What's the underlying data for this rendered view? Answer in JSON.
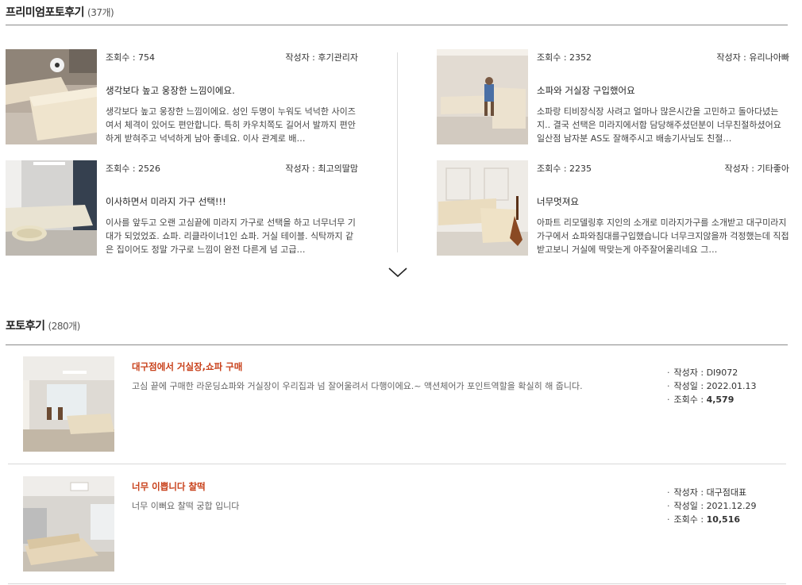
{
  "premium": {
    "title": "프리미엄포토후기",
    "count": "(37개)",
    "cards": [
      {
        "views": "조회수 : 754",
        "author": "작성자 : 후기관리자",
        "title": "생각보다 높고 웅장한 느낌이에요.",
        "desc": "생각보다 높고 웅장한 느낌이에요. 성인 두명이 누워도 넉넉한 사이즈여서 체격이 있어도 편안합니다. 특히 카우치쪽도 길어서 발까지 편안하게 받혀주고 넉넉하게 남아 좋네요. 이사 관계로 배…"
      },
      {
        "views": "조회수 : 2352",
        "author": "작성자 : 유리나아빠",
        "title": "소파와 거실장 구입했어요",
        "desc": "소파랑 티비장식장 사려고 얼마나 많은시간을 고민하고 돌아다녔는지.. 결국 선택은 미라지에서함 담당해주셨던분이 너무친절하셨어요 일산점 남자분 AS도 잘해주시고 배송기사님도 친절…"
      },
      {
        "views": "조회수 : 2526",
        "author": "작성자 : 최고의딸맘",
        "title": "이사하면서 미라지 가구 선택!!!",
        "desc": "이사를 앞두고 오랜 고심끝에 미라지 가구로 선택을 하고 너무너무 기대가 되었었죠. 쇼파. 리클라이너1인 쇼파. 거실 테이블. 식탁까지 같은 집이어도 정말 가구로 느낌이 완전 다른게 넘 고급…"
      },
      {
        "views": "조회수 : 2235",
        "author": "작성자 : 기타좋아",
        "title": "너무멋져요",
        "desc": "아파트 리모델링후 지인의 소개로 미라지가구를 소개받고 대구미라지가구에서 쇼파와침대를구입했습니다 너무크지않을까 걱정했는데 직접 받고보니 거실에 딱맞는게 아주잘어울리네요 그…"
      }
    ]
  },
  "photo": {
    "title": "포토후기",
    "count": "(280개)",
    "rows": [
      {
        "title": "대구점에서 거실장,쇼파 구매",
        "desc": "고심 끝에 구매한 라운딩쇼파와 거실장이 우리집과 넘 잘어울려서 다행이에요.~ 액션체어가 포인트역할을 확실히 해 줍니다.",
        "author_label": "작성자 : ",
        "author": "DI9072",
        "date_label": "작성일 : ",
        "date": "2022.01.13",
        "views_label": "조회수 : ",
        "views": "4,579"
      },
      {
        "title": "너무 이쁩니다 찰떡",
        "desc": "너무 이뻐요 찰떡 궁합 입니다",
        "author_label": "작성자 : ",
        "author": "대구점대표",
        "date_label": "작성일 : ",
        "date": "2021.12.29",
        "views_label": "조회수 : ",
        "views": "10,516"
      }
    ]
  },
  "icons": {
    "more": "chevron-down-icon"
  },
  "colors": {
    "accent": "#c8401a",
    "rule": "#8a8a8a"
  }
}
